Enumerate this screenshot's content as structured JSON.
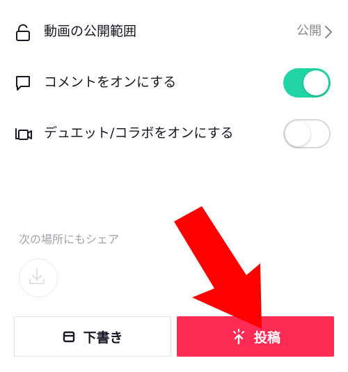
{
  "settings": {
    "privacy": {
      "label": "動画の公開範囲",
      "value": "公開",
      "icon": "lock-icon"
    },
    "comments": {
      "label": "コメントをオンにする",
      "enabled": true,
      "icon": "comment-icon"
    },
    "duet": {
      "label": "デュエット/コラボをオンにする",
      "enabled": false,
      "icon": "duet-icon"
    }
  },
  "share": {
    "label": "次の場所にもシェア",
    "icon": "download-icon"
  },
  "actions": {
    "draft_label": "下書き",
    "post_label": "投稿"
  },
  "colors": {
    "toggle_on": "#20d5a3",
    "post_button": "#fe2c55",
    "arrow": "#ff0000"
  }
}
